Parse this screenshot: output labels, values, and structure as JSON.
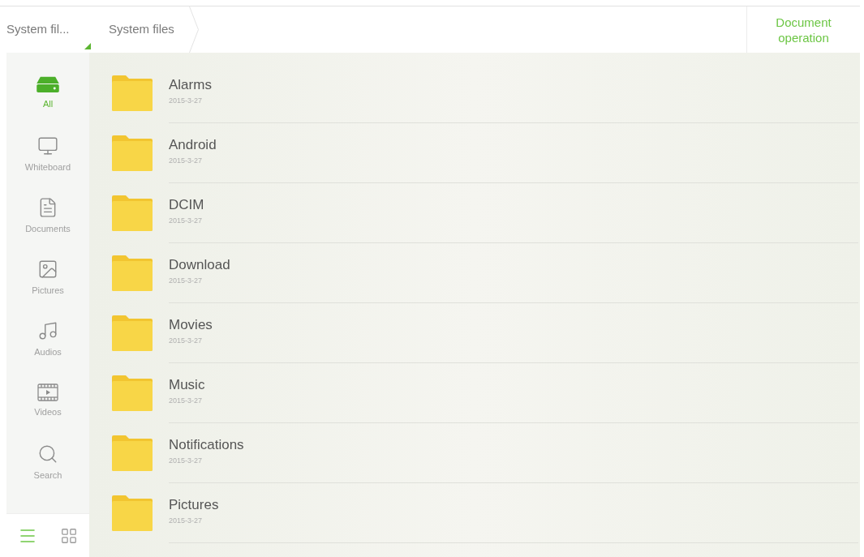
{
  "breadcrumbs": [
    {
      "label": "System fil...",
      "kind": "dropdown"
    },
    {
      "label": "System files",
      "kind": "crumb"
    }
  ],
  "action": {
    "label": "Document operation"
  },
  "sidebar": {
    "items": [
      {
        "label": "All",
        "selected": true
      },
      {
        "label": "Whiteboard",
        "selected": false
      },
      {
        "label": "Documents",
        "selected": false
      },
      {
        "label": "Pictures",
        "selected": false
      },
      {
        "label": "Audios",
        "selected": false
      },
      {
        "label": "Videos",
        "selected": false
      },
      {
        "label": "Search",
        "selected": false
      }
    ]
  },
  "view_modes": [
    {
      "selected": true
    },
    {
      "selected": false
    }
  ],
  "folders": [
    {
      "name": "Alarms",
      "date": "2015-3-27"
    },
    {
      "name": "Android",
      "date": "2015-3-27"
    },
    {
      "name": "DCIM",
      "date": "2015-3-27"
    },
    {
      "name": "Download",
      "date": "2015-3-27"
    },
    {
      "name": "Movies",
      "date": "2015-3-27"
    },
    {
      "name": "Music",
      "date": "2015-3-27"
    },
    {
      "name": "Notifications",
      "date": "2015-3-27"
    },
    {
      "name": "Pictures",
      "date": "2015-3-27"
    }
  ]
}
